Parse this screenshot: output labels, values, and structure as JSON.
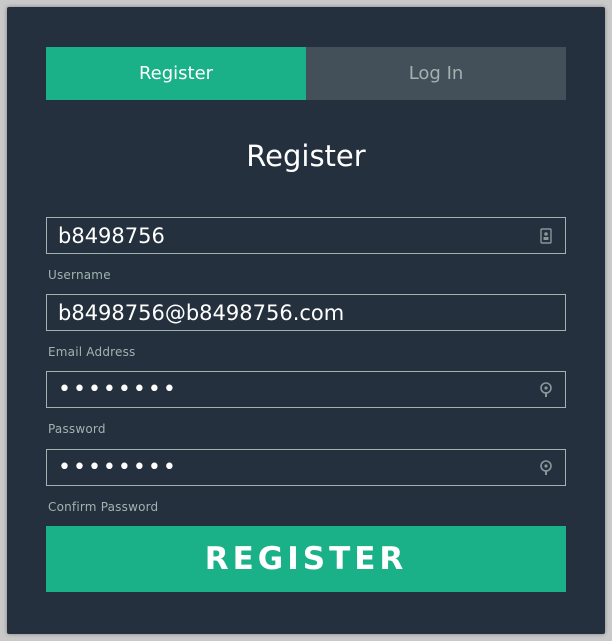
{
  "tabs": {
    "register_label": "Register",
    "login_label": "Log In"
  },
  "form": {
    "title": "Register",
    "username": {
      "value": "b8498756",
      "label": "Username",
      "icon": "id-card-icon"
    },
    "email": {
      "value": "b8498756@b8498756.com",
      "label": "Email Address"
    },
    "password": {
      "value": "12345678",
      "label": "Password",
      "icon": "key-icon"
    },
    "confirm_password": {
      "value": "12345678",
      "label": "Confirm Password",
      "icon": "key-icon"
    },
    "submit_label": "REGISTER"
  },
  "colors": {
    "background": "#24303d",
    "accent": "#1ab188",
    "inactive_tab": "#435059",
    "muted_text": "#a0b3b0"
  }
}
